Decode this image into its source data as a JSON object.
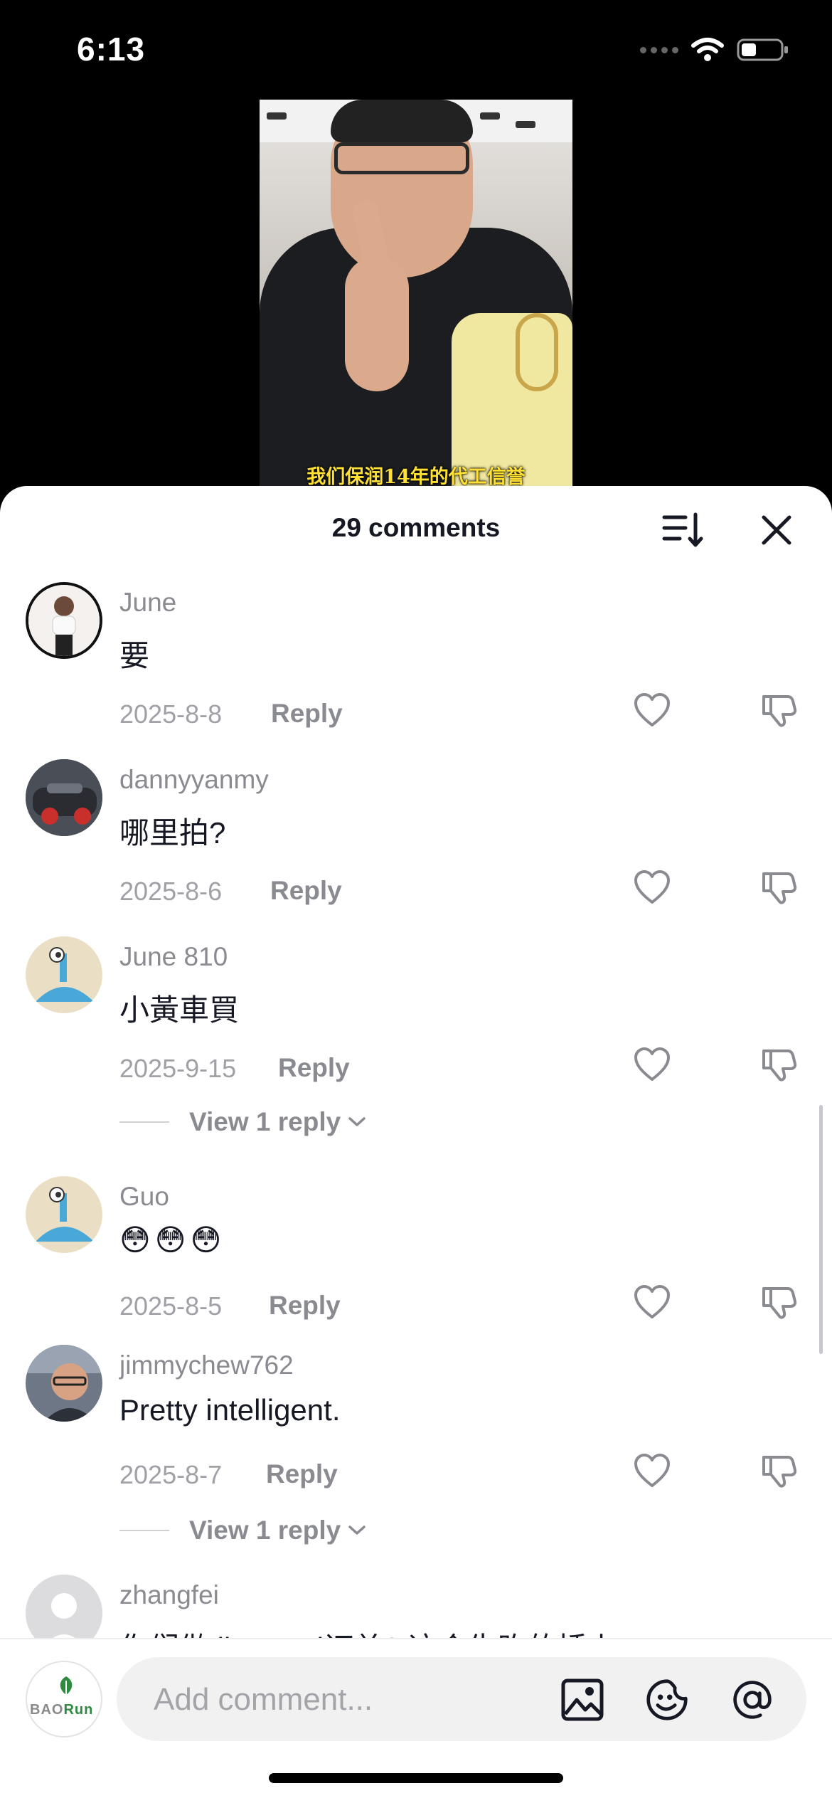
{
  "status_bar": {
    "time": "6:13"
  },
  "video": {
    "caption": "我们保润14年的代工信誉"
  },
  "sheet": {
    "title": "29 comments"
  },
  "comments": [
    {
      "username": "June",
      "text": "要",
      "date": "2025-8-8",
      "reply_label": "Reply"
    },
    {
      "username": "dannyyanmy",
      "text": "哪里拍?",
      "date": "2025-8-6",
      "reply_label": "Reply"
    },
    {
      "username": "June 810",
      "text": "小黃車買",
      "date": "2025-9-15",
      "reply_label": "Reply",
      "view_replies": "View 1 reply"
    },
    {
      "username": "Guo",
      "text": "😳😳😳",
      "date": "2025-8-5",
      "reply_label": "Reply"
    },
    {
      "username": "jimmychew762",
      "text": "Pretty intelligent.",
      "date": "2025-8-7",
      "reply_label": "Reply",
      "view_replies": "View 1 reply"
    },
    {
      "username": "zhangfei",
      "text": "你们做 ll--- --- d订单? 这个生昨的插上"
    }
  ],
  "composer": {
    "placeholder": "Add comment...",
    "brand_prefix": "BAO",
    "brand_suffix": "Run"
  },
  "colors": {
    "text": "#161823",
    "muted": "#8a8b91",
    "input_bg": "#f1f1f2",
    "brand_green": "#2e8a3e"
  }
}
